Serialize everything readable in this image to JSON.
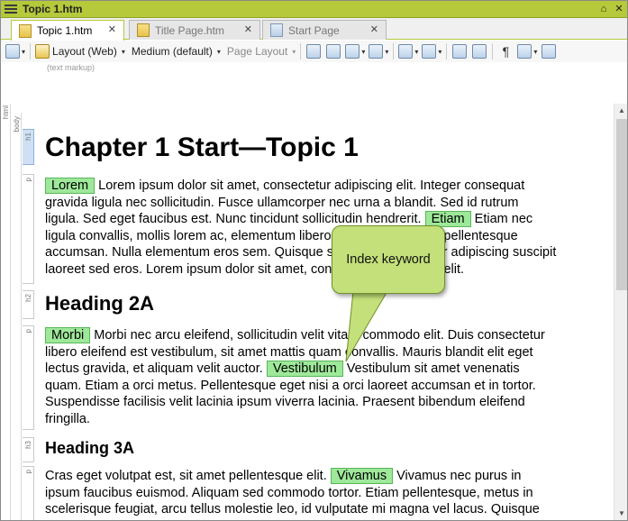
{
  "window": {
    "title": "Topic 1.htm",
    "pin_glyph": "⌂",
    "close_glyph": "✕"
  },
  "tabs": [
    {
      "label": "Topic 1.htm",
      "close": "✕"
    },
    {
      "label": "Title Page.htm",
      "close": "✕"
    },
    {
      "label": "Start Page",
      "close": "✕"
    }
  ],
  "toolbar": {
    "layout_label": "Layout (Web)",
    "medium_label": "Medium (default)",
    "page_layout_label": "Page Layout",
    "pilcrow": "¶",
    "dropdown_glyph": "▾"
  },
  "markup_hint": "(text markup)",
  "structure": {
    "html": "html",
    "body": "body",
    "tags": [
      "h1",
      "p",
      "h2",
      "p",
      "h3",
      "p"
    ]
  },
  "doc": {
    "h1": "Chapter 1 Start—Topic 1",
    "p1": [
      {
        "kw": "Lorem",
        "text": " Lorem ipsum dolor sit amet, consectetur adipiscing elit. Integer consequat"
      },
      {
        "text": "gravida ligula nec sollicitudin. Fusce ullamcorper nec urna a blandit. Sed id rutrum"
      },
      {
        "text": "ligula. Sed eget faucibus est. Nunc tincidunt sollicitudin hendrerit.",
        "kw2": "Etiam",
        "text2": " Etiam nec"
      },
      {
        "text": "ligula convallis, mollis lorem ac, elementum libero. Nunc consectetur pellentesque"
      },
      {
        "text": "accumsan. Nulla elementum eros sem. Quisque sit amet, consectetur adipiscing suscipit"
      },
      {
        "text": "laoreet sed eros. Lorem ipsum dolor sit amet, consectetur adipiscing elit."
      }
    ],
    "h2": "Heading 2A",
    "p2": [
      {
        "kw": "Morbi",
        "text": " Morbi nec arcu eleifend, sollicitudin velit vitae, commodo elit. Duis consectetur"
      },
      {
        "text": "libero eleifend est vestibulum, sit amet mattis quam convallis. Mauris blandit elit eget"
      },
      {
        "text": "lectus gravida, et aliquam velit auctor.",
        "kw2": "Vestibulum",
        "text2": " Vestibulum sit amet venenatis"
      },
      {
        "text": "quam. Etiam a orci metus. Pellentesque eget nisi a orci laoreet accumsan et in tortor."
      },
      {
        "text": "Suspendisse facilisis velit lacinia ipsum viverra lacinia. Praesent bibendum eleifend"
      },
      {
        "text": "fringilla."
      }
    ],
    "h3": "Heading 3A",
    "p3": [
      {
        "text": "Cras eget volutpat est, sit amet pellentesque elit.",
        "kw2": "Vivamus",
        "text2": " Vivamus nec purus in"
      },
      {
        "text": "ipsum faucibus euismod. Aliquam sed commodo tortor. Etiam pellentesque, metus in"
      },
      {
        "text": "scelerisque feugiat, arcu tellus molestie leo, id vulputate mi magna vel lacus. Quisque"
      }
    ]
  },
  "callout": {
    "text": "Index keyword"
  },
  "scrollbar": {
    "up": "▲",
    "down": "▼"
  },
  "colors": {
    "accent": "#b5c93a",
    "keyword_bg": "#9ee89a",
    "callout_bg": "#c4e07a"
  }
}
